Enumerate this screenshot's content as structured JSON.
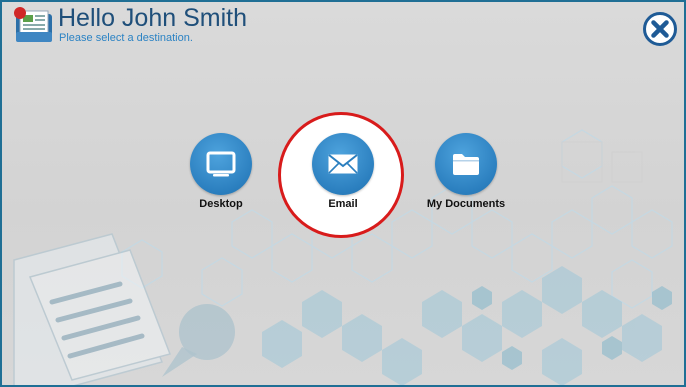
{
  "header": {
    "greeting": "Hello John Smith",
    "subtitle": "Please select a destination."
  },
  "destinations": [
    {
      "label": "Desktop",
      "icon": "monitor-icon"
    },
    {
      "label": "Email",
      "icon": "envelope-icon"
    },
    {
      "label": "My Documents",
      "icon": "folder-icon"
    }
  ],
  "colors": {
    "accent": "#2b7fbf",
    "title": "#1f4f7a",
    "subtitle": "#2c83c4",
    "highlight": "#d81b1b",
    "close": "#1f5b96"
  }
}
